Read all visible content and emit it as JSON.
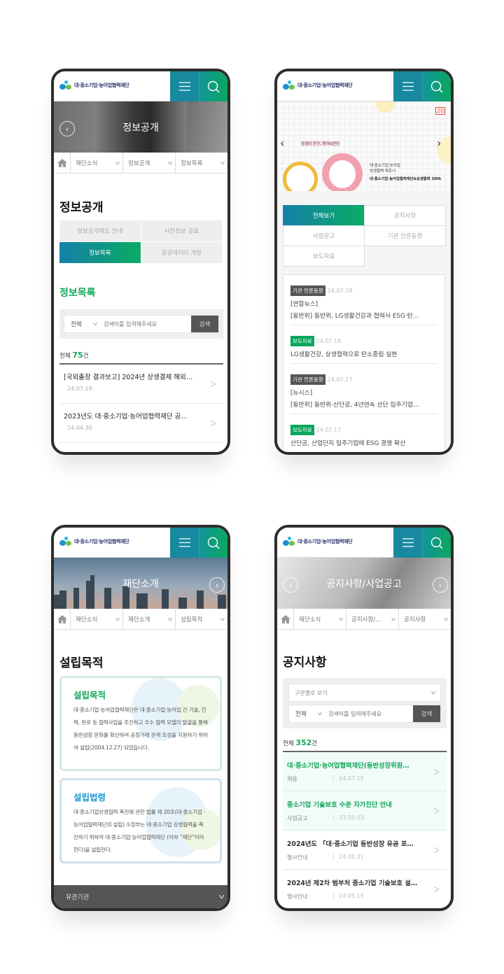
{
  "brand": {
    "logo_text": "대·중소기업·농어업협력재단",
    "accent_teal": "#18899f",
    "accent_green": "#12a65a"
  },
  "phones": [
    {
      "banner_title": "정보공개",
      "breadcrumb": [
        "재단소식",
        "정보공개",
        "정보목록"
      ],
      "page_title": "정보공개",
      "tabs": [
        "정보공개제도 안내",
        "사전정보 공표",
        "정보목록",
        "공공데이터 개방"
      ],
      "section_title": "정보목록",
      "search": {
        "select": "전체",
        "placeholder": "검색어를 입력해주세요",
        "button": "검색"
      },
      "total_label": "전체",
      "total_count": "75",
      "total_unit": "건",
      "items": [
        {
          "title": "[국외출장 결과보고] 2024년 상생결제 해외…",
          "date": "24.07.19"
        },
        {
          "title": "2023년도 대·중소기업·농어업협력재단 공…",
          "date": "24.04.30"
        }
      ]
    },
    {
      "banner": {
        "slogan": "상생의 친구, 동이&반이",
        "line1": "대·중소기업·농어업",
        "line2": "상생협력 파트너",
        "line3": "대·중소기업·농어업협력재단&상생협력 20th",
        "badge": "20"
      },
      "tabs": [
        "전체보기",
        "공지사항",
        "사업공고",
        "기관 언론동향",
        "보도자료"
      ],
      "news": [
        {
          "badge": "기관 언론동향",
          "type": "dark",
          "date": "24.07.18",
          "lines": [
            "[연합뉴스]",
            "[동반위] 동반위, LG생활건강과 협력사 ESG·탄…"
          ]
        },
        {
          "badge": "보도자료",
          "type": "green",
          "date": "24.07.18",
          "lines": [
            "LG생활건강, 상생협력으로 탄소중립 실현"
          ]
        },
        {
          "badge": "기관 언론동향",
          "type": "dark",
          "date": "24.07.17",
          "lines": [
            "[뉴시스]",
            "[동반위] 동반위·산단공, 4년연속 산단 입주기업…"
          ]
        },
        {
          "badge": "보도자료",
          "type": "green",
          "date": "24.07.17",
          "lines": [
            "산단공, 산업단지 입주기업에 ESG 경영 확산"
          ]
        }
      ]
    },
    {
      "banner_title": "재단소개",
      "breadcrumb": [
        "재단소식",
        "재단소개",
        "설립목적"
      ],
      "page_title": "설립목적",
      "card1": {
        "title": "설립목적",
        "text": "대·중소기업·농어업협력재단은 대·중소기업·농어업 간 기술, 인력, 판로 등 협력사업을 추진하고 우수 협력 모델의 발굴을 통해 동반성장 문화를 확산하여 공정거래 관계 조성을 지원하기 위하여 설립(2004.12.27) 되었습니다."
      },
      "card2": {
        "title": "설립법령",
        "text": "대·중소기업상생협력 촉진에 관한 법률 제 20조(대·중소기업 ·농어업협력재단의 설립) ①정부는 대·중소기업 상생협력을 촉진하기 위하여 대·중소기업·농어업협력재단 (이하 “재단”이라 한다)을 설립한다."
      },
      "footer": "유관기관"
    },
    {
      "banner_title": "공지사항/사업공고",
      "breadcrumb": [
        "재단소식",
        "공지사항/…",
        "공지사항"
      ],
      "page_title": "공지사항",
      "filter": "구분별로 보기",
      "search": {
        "select": "전체",
        "placeholder": "검색어를 입력해주세요",
        "button": "검색"
      },
      "total_label": "전체",
      "total_count": "352",
      "total_unit": "건",
      "items": [
        {
          "title": "대·중소기업·농어업협력재단(동반성장위원…",
          "category": "채용",
          "date": "24.07.15"
        },
        {
          "title": "중소기업 기술보호 수준 자가진단 안내",
          "category": "사업공고",
          "date": "23.05.03"
        },
        {
          "title": "2024년도 「대·중소기업 동반성장 유공 포…",
          "category": "행사안내",
          "date": "24.05.31"
        },
        {
          "title": "2024년 제2차 범부처 중소기업 기술보호 설…",
          "category": "행사안내",
          "date": "24.05.13"
        }
      ]
    }
  ]
}
